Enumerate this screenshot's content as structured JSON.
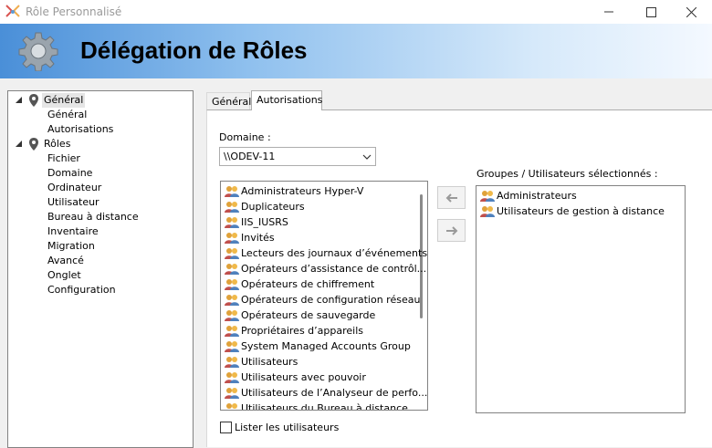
{
  "window": {
    "title": "Rôle Personnalisé",
    "controls": {
      "minimize": "—",
      "maximize": "☐",
      "close": "✕"
    }
  },
  "banner": {
    "title": "Délégation de Rôles",
    "icon": "gear-icon"
  },
  "tree": {
    "general": {
      "label": "Général",
      "children": [
        "Général",
        "Autorisations"
      ]
    },
    "roles": {
      "label": "Rôles",
      "children": [
        "Fichier",
        "Domaine",
        "Ordinateur",
        "Utilisateur",
        "Bureau à distance",
        "Inventaire",
        "Migration",
        "Avancé",
        "Onglet",
        "Configuration"
      ]
    }
  },
  "tabs": [
    "Général",
    "Autorisations"
  ],
  "active_tab": "Autorisations",
  "domain": {
    "label": "Domaine :",
    "value": "\\\\ODEV-11"
  },
  "groups_list": [
    "Administrateurs Hyper-V",
    "Duplicateurs",
    "IIS_IUSRS",
    "Invités",
    "Lecteurs des journaux d’événements",
    "Opérateurs d’assistance de contrôl...",
    "Opérateurs de chiffrement",
    "Opérateurs de configuration réseau",
    "Opérateurs de sauvegarde",
    "Propriétaires d’appareils",
    "System Managed Accounts Group",
    "Utilisateurs",
    "Utilisateurs avec pouvoir",
    "Utilisateurs de l’Analyseur de perfo...",
    "Utilisateurs du Bureau à distance"
  ],
  "selected": {
    "label": "Groupes / Utilisateurs sélectionnés :",
    "items": [
      "Administrateurs",
      "Utilisateurs de gestion à distance"
    ]
  },
  "buttons": {
    "add": "←",
    "remove": "→"
  },
  "checkbox": {
    "label": "Lister les utilisateurs",
    "checked": false
  }
}
